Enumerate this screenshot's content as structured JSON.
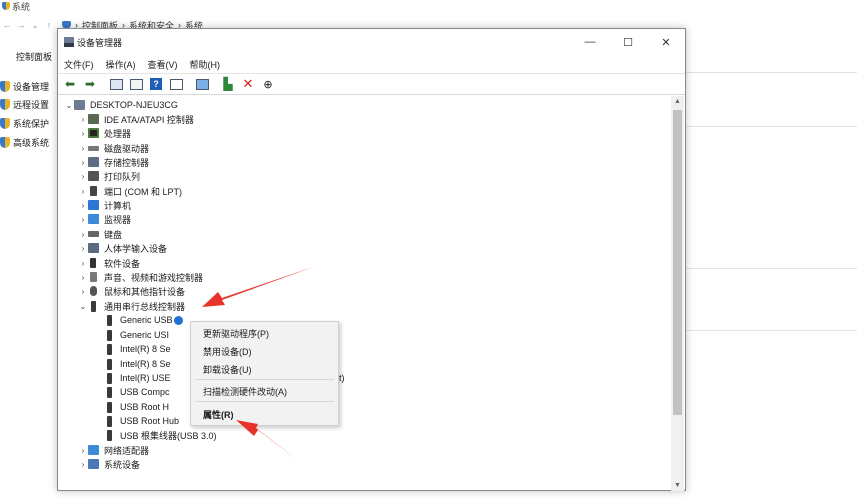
{
  "background_window": {
    "title": "系统",
    "breadcrumbs": [
      "控制面板",
      "系统和安全",
      "系统"
    ],
    "left_nav": {
      "home": "控制面板",
      "items": [
        "设备管理",
        "远程设置",
        "系统保护",
        "高级系统"
      ]
    }
  },
  "device_manager": {
    "title": "设备管理器",
    "window_buttons": [
      "—",
      "☐",
      "✕"
    ],
    "menu": [
      "文件(F)",
      "操作(A)",
      "查看(V)",
      "帮助(H)"
    ],
    "tree": {
      "root": "DESKTOP-NJEU3CG",
      "categories": [
        "IDE ATA/ATAPI 控制器",
        "处理器",
        "磁盘驱动器",
        "存储控制器",
        "打印队列",
        "端口 (COM 和 LPT)",
        "计算机",
        "监视器",
        "键盘",
        "人体学输入设备",
        "软件设备",
        "声音、视频和游戏控制器",
        "鼠标和其他指针设备",
        "通用串行总线控制器"
      ],
      "usb_children": [
        "Generic USB",
        "Generic USI",
        "Intel(R) 8 Se",
        "Intel(R) 8 Se",
        "Intel(R) USE",
        "USB Compc",
        "USB Root H",
        "USB Root Hub",
        "USB 根集线器(USB 3.0)"
      ],
      "usb_child_tail": "t)",
      "after_usb": [
        "网络适配器",
        "系统设备"
      ]
    },
    "context_menu": {
      "update_driver": "更新驱动程序(P)",
      "disable_device": "禁用设备(D)",
      "uninstall_device": "卸载设备(U)",
      "scan_hardware": "扫描检测硬件改动(A)",
      "properties": "属性(R)"
    }
  },
  "colors": {
    "arrow": "#e8332b",
    "accent": "#1f5fb5"
  }
}
